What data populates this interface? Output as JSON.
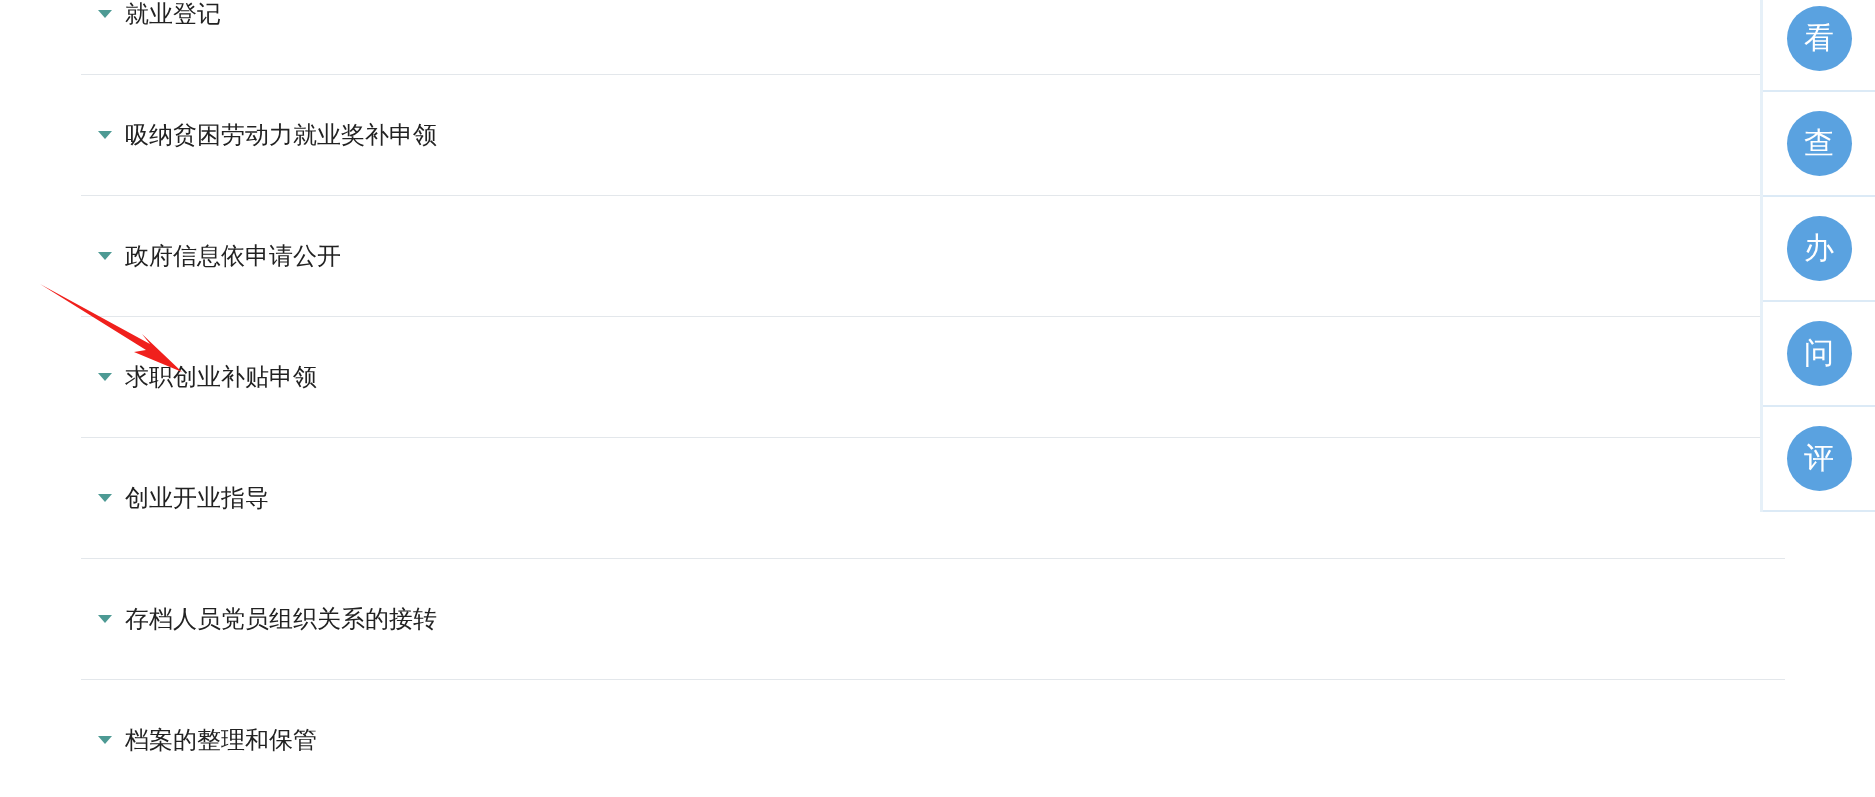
{
  "items": [
    {
      "label": "就业登记"
    },
    {
      "label": "吸纳贫困劳动力就业奖补申领"
    },
    {
      "label": "政府信息依申请公开"
    },
    {
      "label": "求职创业补贴申领"
    },
    {
      "label": "创业开业指导"
    },
    {
      "label": "存档人员党员组织关系的接转"
    },
    {
      "label": "档案的整理和保管"
    }
  ],
  "side_buttons": [
    {
      "label": "看"
    },
    {
      "label": "查"
    },
    {
      "label": "办"
    },
    {
      "label": "问"
    },
    {
      "label": "评"
    }
  ]
}
